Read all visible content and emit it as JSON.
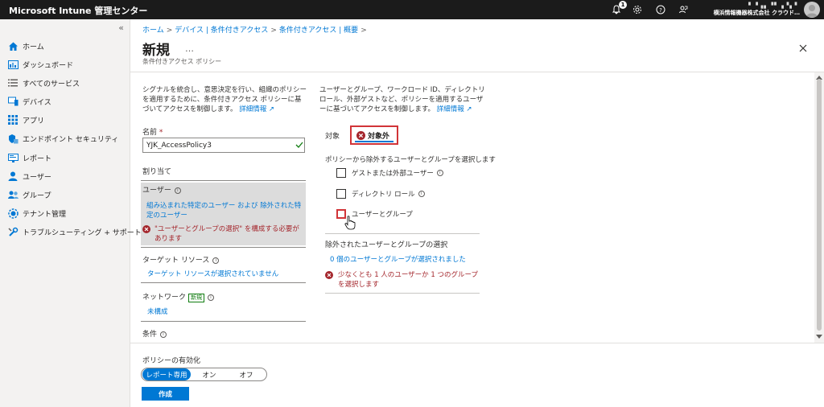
{
  "app": {
    "title": "Microsoft Intune 管理センター",
    "notification_count": "1",
    "account_line1": "▘▝▗▖▝▘▗▝▖▘",
    "account_line2": "横浜情報機器株式会社  クラウド…"
  },
  "sidebar": {
    "collapse": "«",
    "items": [
      {
        "label": "ホーム",
        "icon": "home-icon"
      },
      {
        "label": "ダッシュボード",
        "icon": "dashboard-icon"
      },
      {
        "label": "すべてのサービス",
        "icon": "list-icon"
      },
      {
        "label": "デバイス",
        "icon": "devices-icon"
      },
      {
        "label": "アプリ",
        "icon": "apps-icon"
      },
      {
        "label": "エンドポイント セキュリティ",
        "icon": "shield-icon"
      },
      {
        "label": "レポート",
        "icon": "reports-icon"
      },
      {
        "label": "ユーザー",
        "icon": "user-icon"
      },
      {
        "label": "グループ",
        "icon": "group-icon"
      },
      {
        "label": "テナント管理",
        "icon": "tenant-icon"
      },
      {
        "label": "トラブルシューティング + サポート",
        "icon": "wrench-icon"
      }
    ]
  },
  "breadcrumb": [
    "ホーム",
    "デバイス | 条件付きアクセス",
    "条件付きアクセス | 概要"
  ],
  "page": {
    "title": "新規",
    "more": "…",
    "subtitle": "条件付きアクセス ポリシー"
  },
  "left": {
    "description": "シグナルを統合し、意思決定を行い、組織のポリシーを適用するために、条件付きアクセス ポリシーに基づいてアクセスを制御します。",
    "learn_more": "詳細情報",
    "name_label": "名前",
    "required_mark": "*",
    "name_value": "YJK_AccessPolicy3",
    "assignments_label": "割り当て",
    "users_title": "ユーザー",
    "users_link": "組み込まれた特定のユーザー および 除外された特定のユーザー",
    "users_error": "\"ユーザーとグループの選択\" を構成する必要があります",
    "target_title": "ターゲット リソース",
    "target_link": "ターゲット リソースが選択されていません",
    "network_title": "ネットワーク",
    "network_badge": "新規",
    "network_link": "未構成",
    "conditions_title": "条件"
  },
  "right": {
    "description": "ユーザーとグループ、ワークロード ID、ディレクトリ ロール、外部ゲストなど、ポリシーを適用するユーザーに基づいてアクセスを制御します。",
    "learn_more": "詳細情報",
    "tab_include": "対象",
    "tab_exclude": "対象外",
    "exclude_desc": "ポリシーから除外するユーザーとグループを選択します",
    "checkboxes": [
      "ゲストまたは外部ユーザー",
      "ディレクトリ ロール",
      "ユーザーとグループ"
    ],
    "excluded_title": "除外されたユーザーとグループの選択",
    "excluded_count": "0 個のユーザーとグループが選択されました",
    "excluded_error": "少なくとも 1 人のユーザーか 1 つのグループを選択します"
  },
  "footer": {
    "enable_label": "ポリシーの有効化",
    "options": [
      "レポート専用",
      "オン",
      "オフ"
    ],
    "selected": "レポート専用",
    "create": "作成"
  },
  "colors": {
    "accent": "#0078d4",
    "error": "#a4262c",
    "highlight": "#d13438",
    "topbar": "#1b1b1b"
  }
}
